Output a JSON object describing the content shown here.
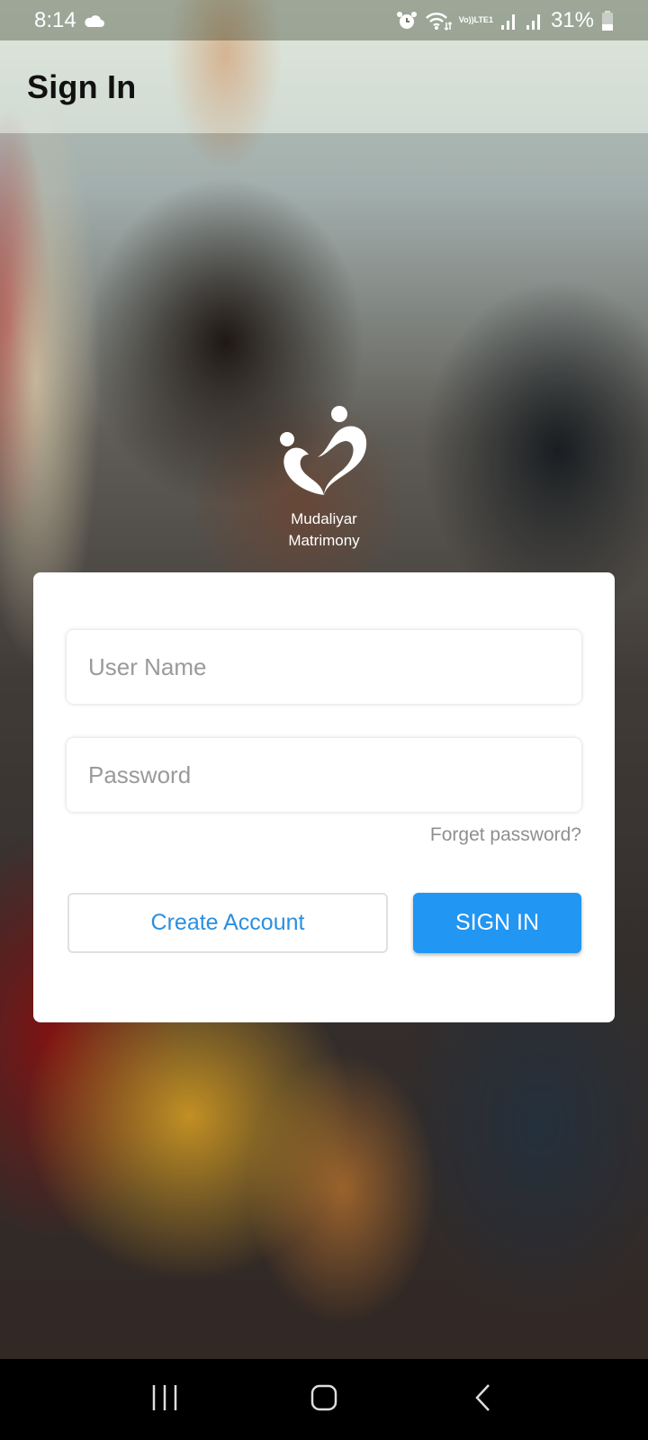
{
  "status_bar": {
    "time": "8:14",
    "weather_icon": "cloud-icon",
    "battery_percent": "31%",
    "network_label_top": "Vo))",
    "network_label_bottom": "LTE1",
    "icons": [
      "alarm-icon",
      "wifi-icon",
      "volte-icon",
      "signal-icon",
      "signal-icon",
      "battery-icon"
    ]
  },
  "header": {
    "title": "Sign In"
  },
  "logo": {
    "line1": "Mudaliyar",
    "line2": "Matrimony"
  },
  "form": {
    "username_placeholder": "User Name",
    "username_value": "",
    "password_placeholder": "Password",
    "password_value": "",
    "forgot_label": "Forget password?",
    "create_account_label": "Create Account",
    "sign_in_label": "SIGN IN"
  },
  "colors": {
    "primary": "#2196f3",
    "link_text": "#2b8fe0",
    "placeholder": "#9a9a9a"
  },
  "nav_bar": {
    "buttons": [
      "recents-icon",
      "home-icon",
      "back-icon"
    ]
  }
}
